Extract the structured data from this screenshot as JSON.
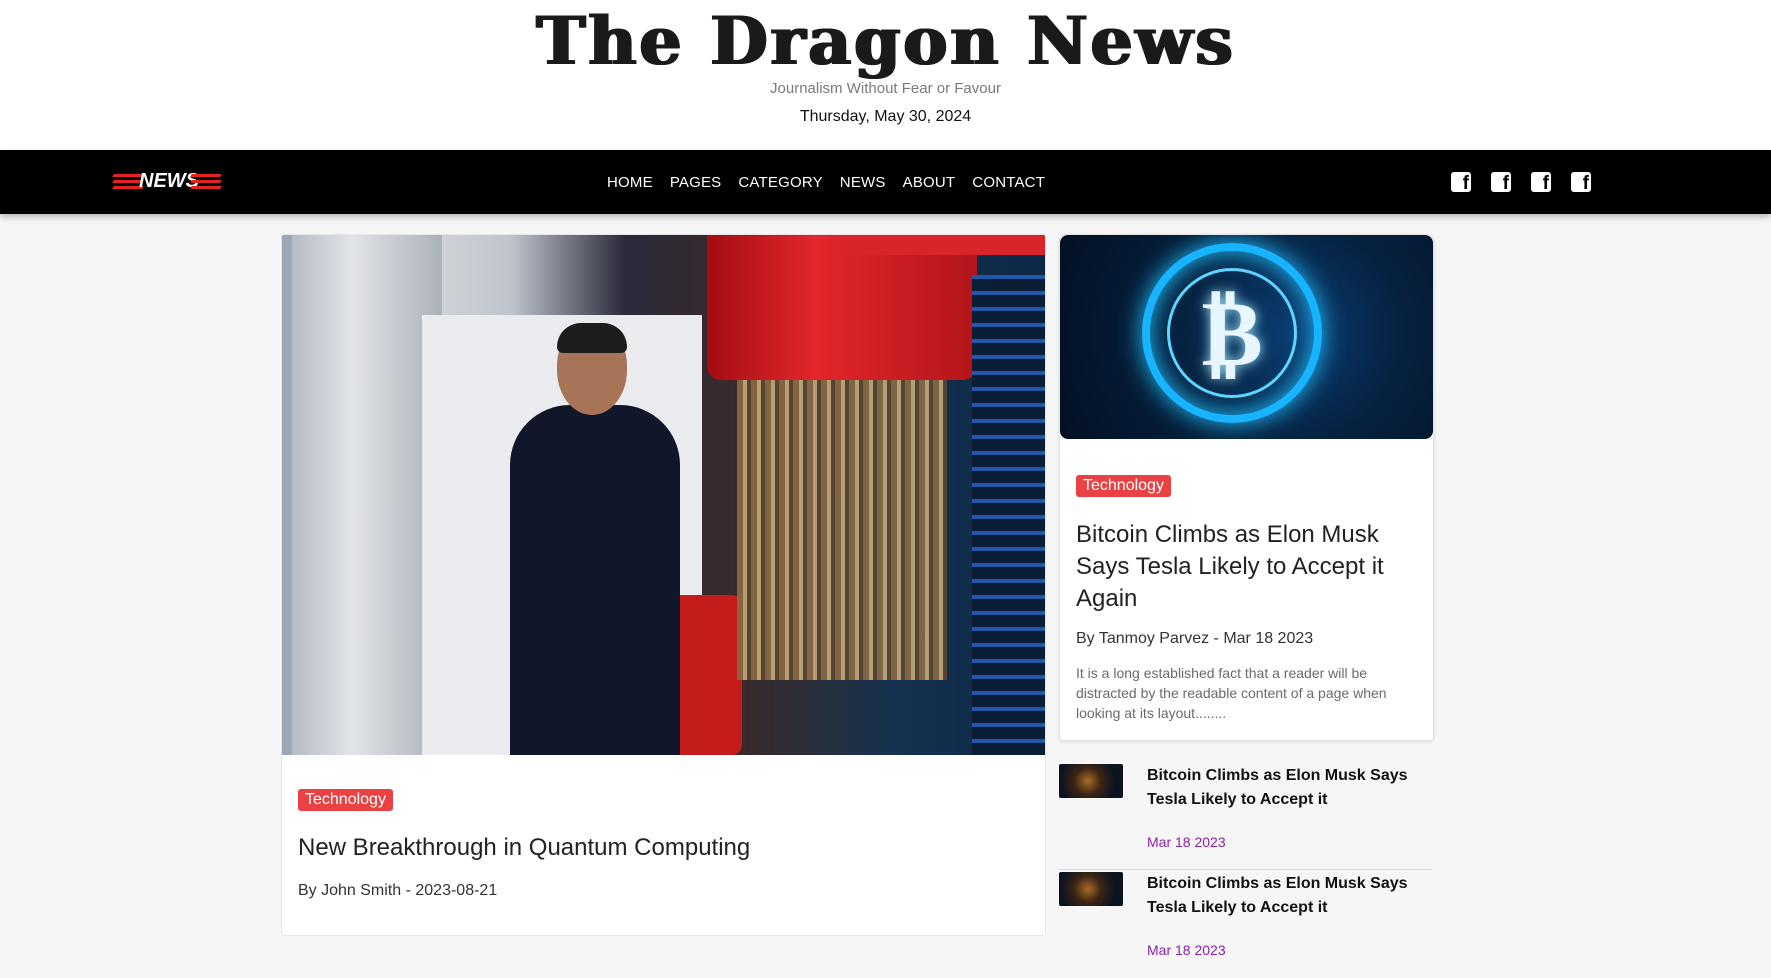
{
  "masthead": {
    "title": "The Dragon News",
    "tagline": "Journalism Without Fear or Favour",
    "date": "Thursday, May 30, 2024"
  },
  "navbar": {
    "brand": "NEWS",
    "menu": [
      "HOME",
      "PAGES",
      "CATEGORY",
      "NEWS",
      "ABOUT",
      "CONTACT"
    ],
    "social_icons": [
      "facebook-icon",
      "facebook-icon",
      "facebook-icon",
      "facebook-icon"
    ]
  },
  "featured": {
    "category": "Technology",
    "title": "New Breakthrough in Quantum Computing",
    "byline": "By John Smith - 2023-08-21"
  },
  "side_card": {
    "category": "Technology",
    "title": "Bitcoin Climbs as Elon Musk Says Tesla Likely to Accept it Again",
    "byline": "By Tanmoy Parvez - Mar 18 2023",
    "excerpt": "It is a long established fact that a reader will be distracted by the readable content of a page when looking at its layout........"
  },
  "side_list": [
    {
      "title": "Bitcoin Climbs as Elon Musk Says Tesla Likely to Accept it",
      "date": "Mar 18 2023"
    },
    {
      "title": "Bitcoin Climbs as Elon Musk Says Tesla Likely to Accept it",
      "date": "Mar 18 2023"
    }
  ],
  "colors": {
    "accent": "#ea4244",
    "navbar": "#000000",
    "date_purple": "#8a22a8"
  }
}
